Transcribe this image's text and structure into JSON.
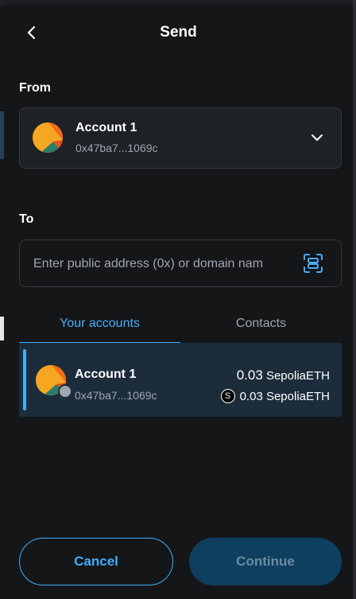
{
  "header": {
    "title": "Send",
    "back_icon": "chevron-left-icon"
  },
  "from": {
    "label": "From",
    "account_name": "Account 1",
    "account_address": "0x47ba7...1069c",
    "chevron_icon": "chevron-down-icon"
  },
  "to": {
    "label": "To",
    "placeholder": "Enter public address (0x) or domain nam",
    "value": "",
    "scan_icon": "qr-scan-icon"
  },
  "tabs": [
    {
      "label": "Your accounts",
      "active": true
    },
    {
      "label": "Contacts",
      "active": false
    }
  ],
  "accounts": [
    {
      "name": "Account 1",
      "address": "0x47ba7...1069c",
      "balance_amount": "0.03",
      "balance_unit": "SepoliaETH",
      "token_symbol": "S",
      "token_balance": "0.03 SepoliaETH",
      "selected": true
    }
  ],
  "footer": {
    "cancel_label": "Cancel",
    "continue_label": "Continue"
  },
  "colors": {
    "accent": "#43aefc",
    "background": "#141618",
    "selected_row": "#1c2c3b",
    "continue_disabled": "#0e3f5f"
  }
}
